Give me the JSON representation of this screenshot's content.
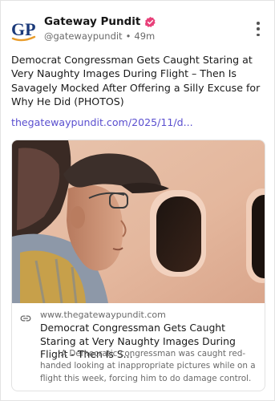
{
  "post": {
    "author_name": "Gateway Pundit",
    "handle": "@gatewaypundit",
    "separator": "•",
    "time_ago": "49m",
    "logo_text": "GP",
    "text": "Democrat Congressman Gets Caught Staring at Very Naughty Images During Flight – Then Is Savagely Mocked After Offering a Silly Excuse for Why He Did (PHOTOS)",
    "link": "thegatewaypundit.com/2025/11/d..."
  },
  "link_card": {
    "domain": "www.thegatewaypundit.com",
    "title": "Democrat Congressman Gets Caught Staring at Very Naughty Images During Flight - Then Is S...",
    "description": "A Democratic congressman was caught red-handed looking at inappropriate pictures while on a flight this week, forcing him to do damage control."
  },
  "icons": {
    "verified": "verified-badge-icon",
    "more": "more-vertical-icon",
    "link": "link-chain-icon"
  },
  "colors": {
    "verified_badge": "#e8417a",
    "link_text": "#5a4fcf",
    "logo_blue": "#1b3a7a",
    "logo_orange": "#e99c2a"
  }
}
